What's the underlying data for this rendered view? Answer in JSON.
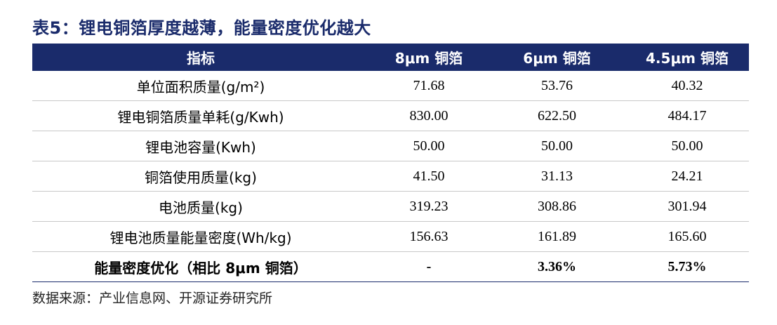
{
  "title": "表5：锂电铜箔厚度越薄，能量密度优化越大",
  "table": {
    "headers": [
      "指标",
      "8μm 铜箔",
      "6μm 铜箔",
      "4.5μm 铜箔"
    ],
    "rows": [
      [
        "单位面积质量(g/m²)",
        "71.68",
        "53.76",
        "40.32"
      ],
      [
        "锂电铜箔质量单耗(g/Kwh)",
        "830.00",
        "622.50",
        "484.17"
      ],
      [
        "锂电池容量(Kwh)",
        "50.00",
        "50.00",
        "50.00"
      ],
      [
        "铜箔使用质量(kg)",
        "41.50",
        "31.13",
        "24.21"
      ],
      [
        "电池质量(kg)",
        "319.23",
        "308.86",
        "301.94"
      ],
      [
        "锂电池质量能量密度(Wh/kg)",
        "156.63",
        "161.89",
        "165.60"
      ],
      [
        "能量密度优化（相比 8μm 铜箔）",
        "-",
        "3.36%",
        "5.73%"
      ]
    ]
  },
  "source": "数据来源：产业信息网、开源证券研究所",
  "colors": {
    "header_bg": "#1a2b6b",
    "title": "#1a2b6b",
    "header_text": "#ffffff"
  }
}
